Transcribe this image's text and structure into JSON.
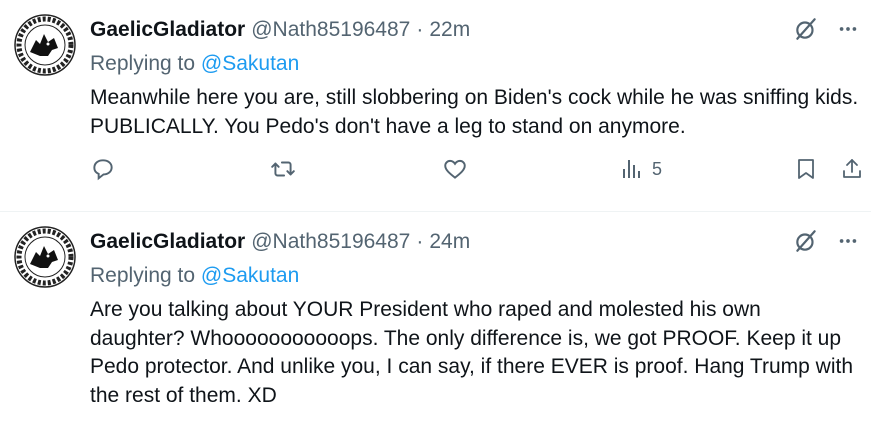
{
  "tweets": [
    {
      "name": "GaelicGladiator",
      "handle": "@Nath85196487",
      "separator": "·",
      "time": "22m",
      "reply_prefix": "Replying to",
      "reply_to": "@Sakutan",
      "text": "Meanwhile here you are, still slobbering on Biden's cock while he was sniffing kids. PUBLICALLY. You Pedo's don't have a leg to stand on anymore.",
      "views": "5"
    },
    {
      "name": "GaelicGladiator",
      "handle": "@Nath85196487",
      "separator": "·",
      "time": "24m",
      "reply_prefix": "Replying to",
      "reply_to": "@Sakutan",
      "text": "Are you talking about YOUR President who raped and molested his own daughter? Whooooooooooops. The only difference is, we got PROOF. Keep it up Pedo protector. And unlike you, I can say, if there EVER is proof. Hang Trump with the rest of them. XD"
    }
  ],
  "icons": {
    "grok": "grok-icon",
    "more": "more-icon",
    "reply": "reply-icon",
    "retweet": "retweet-icon",
    "like": "like-icon",
    "views": "views-icon",
    "bookmark": "bookmark-icon",
    "share": "share-icon"
  },
  "colors": {
    "text": "#0f1419",
    "secondary": "#536471",
    "link": "#1d9bf0",
    "divider": "#eff3f4"
  }
}
